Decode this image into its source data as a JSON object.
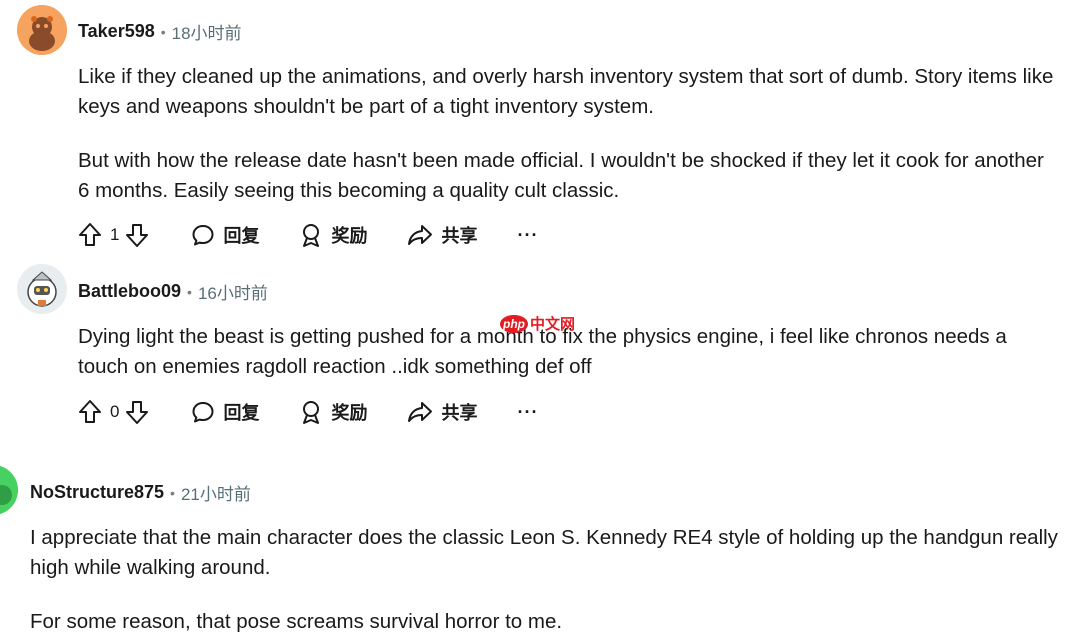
{
  "comments": [
    {
      "username": "Taker598",
      "time": "18小时前",
      "paragraphs": [
        "Like if they cleaned up the animations, and overly harsh inventory system that sort of dumb. Story items like keys and weapons shouldn't be part of a tight inventory system.",
        "But with how the release date hasn't been made official. I wouldn't be shocked if they let it cook for another 6 months. Easily seeing this becoming a quality cult classic."
      ],
      "score": "1",
      "reply_label": "回复",
      "award_label": "奖励",
      "share_label": "共享",
      "more_label": "···"
    },
    {
      "username": "Battleboo09",
      "time": "16小时前",
      "paragraphs": [
        "Dying light the beast is getting pushed for a month to fix the physics engine, i feel like chronos needs a touch on enemies ragdoll reaction ..idk something def off"
      ],
      "score": "0",
      "reply_label": "回复",
      "award_label": "奖励",
      "share_label": "共享",
      "more_label": "···"
    },
    {
      "username": "NoStructure875",
      "time": "21小时前",
      "paragraphs": [
        "I appreciate that the main character does the classic Leon S. Kennedy RE4 style of holding up the handgun really high while walking around.",
        "For some reason, that pose screams survival horror to me."
      ]
    }
  ],
  "separator": "•",
  "watermark": {
    "logo": "php",
    "text": "中文网"
  },
  "colors": {
    "text": "#1a1a1b",
    "meta": "#576f76",
    "avatar1": "#f5a25d",
    "avatar3": "#46d160",
    "watermark": "#e31b23"
  },
  "icons": [
    "upvote-icon",
    "downvote-icon",
    "comment-icon",
    "award-icon",
    "share-icon",
    "more-icon"
  ]
}
